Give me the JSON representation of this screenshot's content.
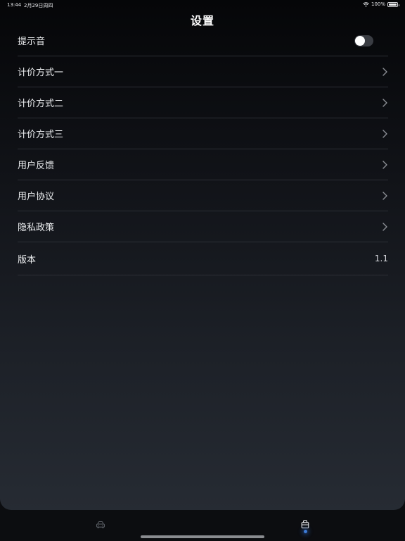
{
  "status_bar": {
    "time": "13:44",
    "date": "2月29日周四",
    "battery": "100%",
    "battery_level": 1.0
  },
  "header": {
    "title": "设置"
  },
  "settings": {
    "sound": {
      "label": "提示音",
      "enabled": false
    },
    "pricing_1": {
      "label": "计价方式一"
    },
    "pricing_2": {
      "label": "计价方式二"
    },
    "pricing_3": {
      "label": "计价方式三"
    },
    "feedback": {
      "label": "用户反馈"
    },
    "agreement": {
      "label": "用户协议"
    },
    "privacy": {
      "label": "隐私政策"
    },
    "version": {
      "label": "版本",
      "value": "1.1"
    }
  },
  "tab_bar": {
    "tabs": [
      {
        "icon": "car-icon",
        "active": false
      },
      {
        "icon": "shopping-bag-icon",
        "active": true
      }
    ]
  },
  "colors": {
    "accent": "#3d7bd6",
    "background_top": "#050608",
    "background_bottom": "#262b33"
  }
}
